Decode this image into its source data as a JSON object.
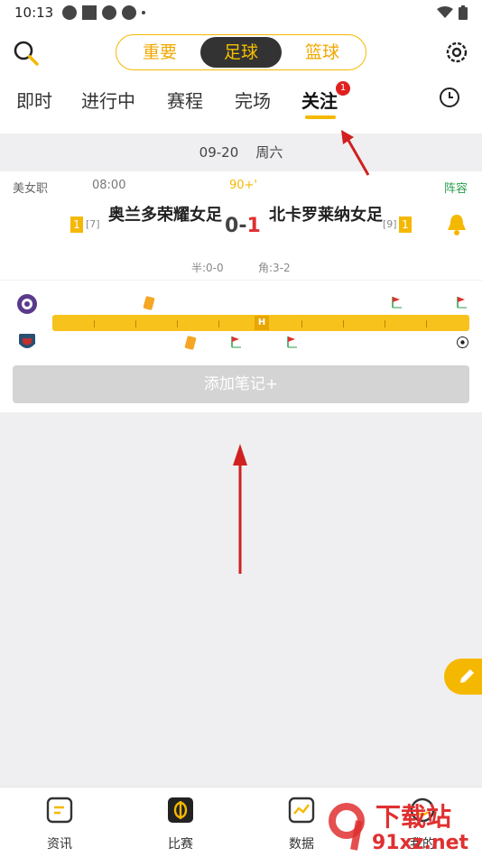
{
  "status_bar": {
    "time": "10:13"
  },
  "header": {
    "segments": [
      "重要",
      "足球",
      "篮球"
    ],
    "active_segment": "足球",
    "tabs": [
      "即时",
      "进行中",
      "赛程",
      "完场",
      "关注"
    ],
    "active_tab": "关注",
    "follow_badge": "1"
  },
  "date_bar": {
    "date": "09-20",
    "weekday": "周六"
  },
  "match": {
    "league": "美女职",
    "time": "08:00",
    "status": "90+'",
    "lineup_label": "阵容",
    "home": {
      "name": "奥兰多荣耀女足",
      "rank": "[7]",
      "yellow_cards": "1"
    },
    "away": {
      "name": "北卡罗莱纳女足",
      "rank": "[9]",
      "yellow_cards": "1"
    },
    "score_home": "0",
    "score_sep": "-",
    "score_away": "1",
    "half_time": "半:0-0",
    "corners": "角:3-2"
  },
  "timeline": {
    "half_marker": "H"
  },
  "add_note_label": "添加笔记+",
  "bottom_nav": [
    "资讯",
    "比赛",
    "数据",
    "我的"
  ],
  "watermark": {
    "brand": "下载站",
    "site": "91xz.net"
  },
  "colors": {
    "accent": "#f5b800",
    "dark": "#333333",
    "red": "#e03030",
    "green": "#2a9d4a"
  }
}
